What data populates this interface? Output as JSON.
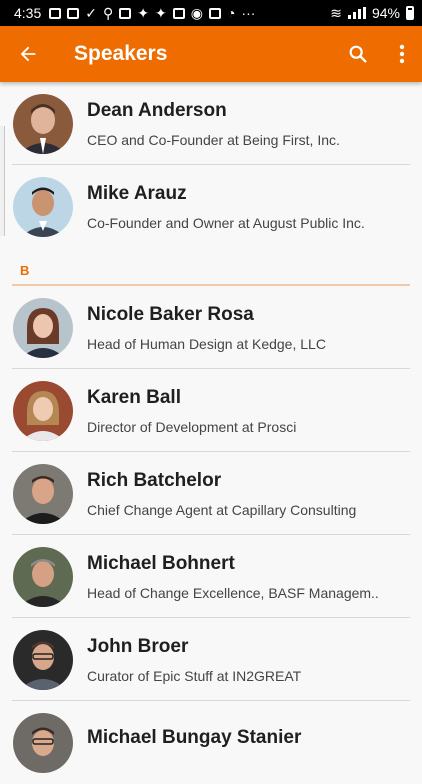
{
  "status_bar": {
    "time": "4:35",
    "battery": "94%"
  },
  "app_bar": {
    "title": "Speakers"
  },
  "colors": {
    "accent": "#ef6c00",
    "status_bar": "#000000"
  },
  "sections": [
    {
      "letter": "",
      "speakers": [
        {
          "name": "Dean Anderson",
          "title": "CEO and Co-Founder at Being First, Inc."
        },
        {
          "name": "Mike Arauz",
          "title": "Co-Founder and Owner at August Public Inc."
        }
      ]
    },
    {
      "letter": "B",
      "speakers": [
        {
          "name": "Nicole Baker Rosa",
          "title": "Head of Human Design at Kedge, LLC"
        },
        {
          "name": "Karen Ball",
          "title": "Director of Development at Prosci"
        },
        {
          "name": "Rich Batchelor",
          "title": "Chief Change Agent at Capillary Consulting"
        },
        {
          "name": "Michael Bohnert",
          "title": "Head of Change Excellence, BASF Managem.."
        },
        {
          "name": "John Broer",
          "title": "Curator of Epic Stuff at IN2GREAT"
        },
        {
          "name": "Michael Bungay Stanier",
          "title": ""
        }
      ]
    }
  ]
}
